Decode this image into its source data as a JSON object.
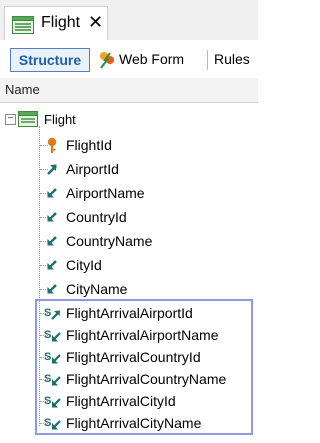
{
  "document_tab": {
    "title": "Flight",
    "close_symbol": "✕"
  },
  "toolbar": {
    "structure": "Structure",
    "webform": "Web Form",
    "rules": "Rules"
  },
  "tree_header": {
    "name": "Name"
  },
  "tree": {
    "root": {
      "label": "Flight",
      "expander": "−"
    },
    "attributes": [
      {
        "label": "FlightId",
        "icon": "key-icon"
      },
      {
        "label": "AirportId",
        "icon": "foreign-key-arrow-icon"
      },
      {
        "label": "AirportName",
        "icon": "inferred-attribute-icon"
      },
      {
        "label": "CountryId",
        "icon": "inferred-attribute-icon"
      },
      {
        "label": "CountryName",
        "icon": "inferred-attribute-icon"
      },
      {
        "label": "CityId",
        "icon": "inferred-attribute-icon"
      },
      {
        "label": "CityName",
        "icon": "inferred-attribute-icon"
      },
      {
        "label": "FlightArrivalAirportId",
        "icon": "subtype-foreign-key-icon"
      },
      {
        "label": "FlightArrivalAirportName",
        "icon": "subtype-inferred-icon"
      },
      {
        "label": "FlightArrivalCountryId",
        "icon": "subtype-inferred-icon"
      },
      {
        "label": "FlightArrivalCountryName",
        "icon": "subtype-inferred-icon"
      },
      {
        "label": "FlightArrivalCityId",
        "icon": "subtype-inferred-icon"
      },
      {
        "label": "FlightArrivalCityName",
        "icon": "subtype-inferred-icon"
      }
    ]
  },
  "colors": {
    "accent": "#1f5faa",
    "key": "#e07a1a",
    "attribute_arrow": "#1f6f6a",
    "selection": "#8d99e0"
  }
}
